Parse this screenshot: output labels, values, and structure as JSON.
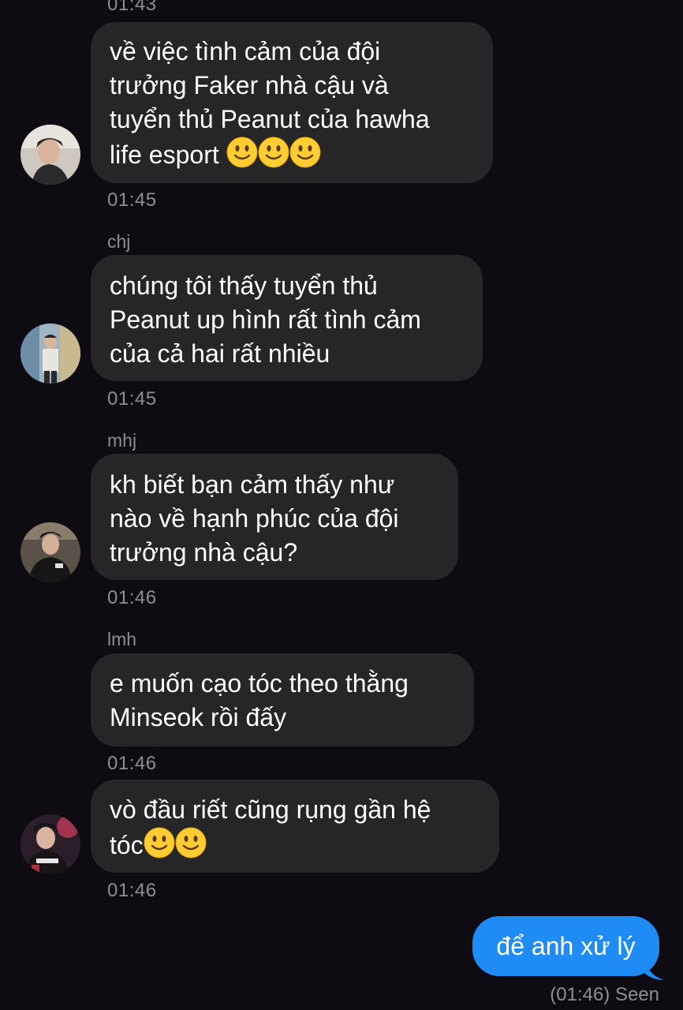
{
  "chat": {
    "top_time": "01:43",
    "messages": [
      {
        "sender": "",
        "lines": [
          "về việc tình cảm của đội",
          "trưởng Faker nhà cậu và",
          "tuyển thủ Peanut của hawha",
          "life esport"
        ],
        "emoji_count": 3,
        "time": "01:45"
      },
      {
        "sender": "chj",
        "lines": [
          "chúng tôi thấy tuyển thủ",
          "Peanut up hình rất tình cảm",
          "của cả hai rất nhiều"
        ],
        "time": "01:45"
      },
      {
        "sender": "mhj",
        "lines": [
          "kh biết bạn cảm thấy như",
          "nào về hạnh phúc của đội",
          "trưởng nhà cậu?"
        ],
        "time": "01:46"
      },
      {
        "sender": "lmh",
        "lines": [
          "e muốn cạo tóc theo thằng",
          "Minseok rồi đấy"
        ],
        "time": "01:46"
      },
      {
        "sender": "",
        "lines": [
          "vò đầu riết cũng rụng gần hệ",
          "tóc"
        ],
        "emoji_count": 2,
        "time": "01:46"
      }
    ],
    "outgoing": {
      "text": "để anh xử lý",
      "status": "(01:46) Seen"
    }
  },
  "colors": {
    "background": "#0e0b12",
    "incoming_bubble": "#262629",
    "outgoing_bubble": "#1f8bf5",
    "meta_text": "#8e8e93"
  },
  "icons": [
    "avatar",
    "slightly-smiling-face-emoji"
  ]
}
